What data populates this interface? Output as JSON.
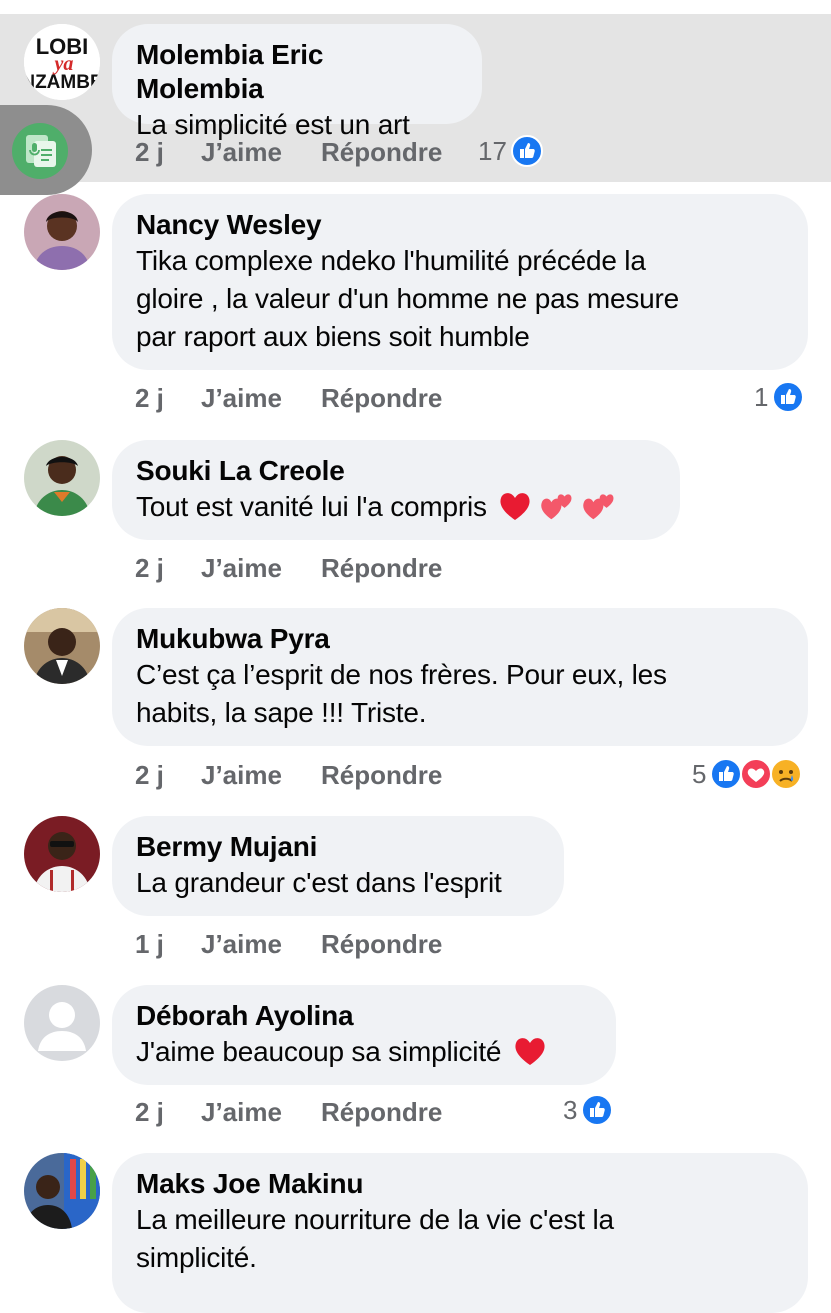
{
  "comments": [
    {
      "author": "Molembia Eric Molembia",
      "avatar_text": [
        "LOBI",
        "ya",
        "NZAMBE"
      ],
      "lines": [
        "La simplicité est un art"
      ],
      "time": "2 j",
      "like_label": "J’aime",
      "reply_label": "Répondre",
      "reaction_count": "17"
    },
    {
      "author": "Nancy Wesley",
      "lines": [
        "Tika complexe ndeko l'humilité précéde la",
        "gloire , la valeur d'un homme ne pas mesure",
        "par raport aux biens soit humble"
      ],
      "time": "2 j",
      "like_label": "J’aime",
      "reply_label": "Répondre",
      "reaction_count": "1"
    },
    {
      "author": "Souki La Creole",
      "lines": [
        "Tout est vanité lui l'a compris"
      ],
      "time": "2 j",
      "like_label": "J’aime",
      "reply_label": "Répondre",
      "reaction_count": ""
    },
    {
      "author": "Mukubwa Pyra",
      "lines": [
        "C’est ça l’esprit de nos frères. Pour eux, les",
        "habits, la sape !!! Triste."
      ],
      "time": "2 j",
      "like_label": "J’aime",
      "reply_label": "Répondre",
      "reaction_count": "5"
    },
    {
      "author": "Bermy Mujani",
      "lines": [
        "La grandeur c'est dans l'esprit"
      ],
      "time": "1 j",
      "like_label": "J’aime",
      "reply_label": "Répondre",
      "reaction_count": ""
    },
    {
      "author": "Déborah Ayolina",
      "lines": [
        "J'aime beaucoup sa simplicité"
      ],
      "time": "2 j",
      "like_label": "J’aime",
      "reply_label": "Répondre",
      "reaction_count": "3"
    },
    {
      "author": "Maks Joe Makinu",
      "lines": [
        "La meilleure nourriture de la vie c'est la",
        "simplicité."
      ]
    }
  ],
  "colors": {
    "like_blue": "#1877f2",
    "love_red": "#f33e58",
    "meta_gray": "#65676b",
    "bubble_bg": "#f0f2f5",
    "highlight_bg": "#e4e4e4"
  },
  "icons": {
    "floating_button": "voice-to-text-icon",
    "like_reaction": "like-reaction-icon",
    "love_reaction": "love-reaction-icon",
    "sad_reaction": "sad-reaction-icon",
    "heart_emoji": "red-heart-emoji",
    "hearts_emoji": "two-hearts-emoji"
  }
}
